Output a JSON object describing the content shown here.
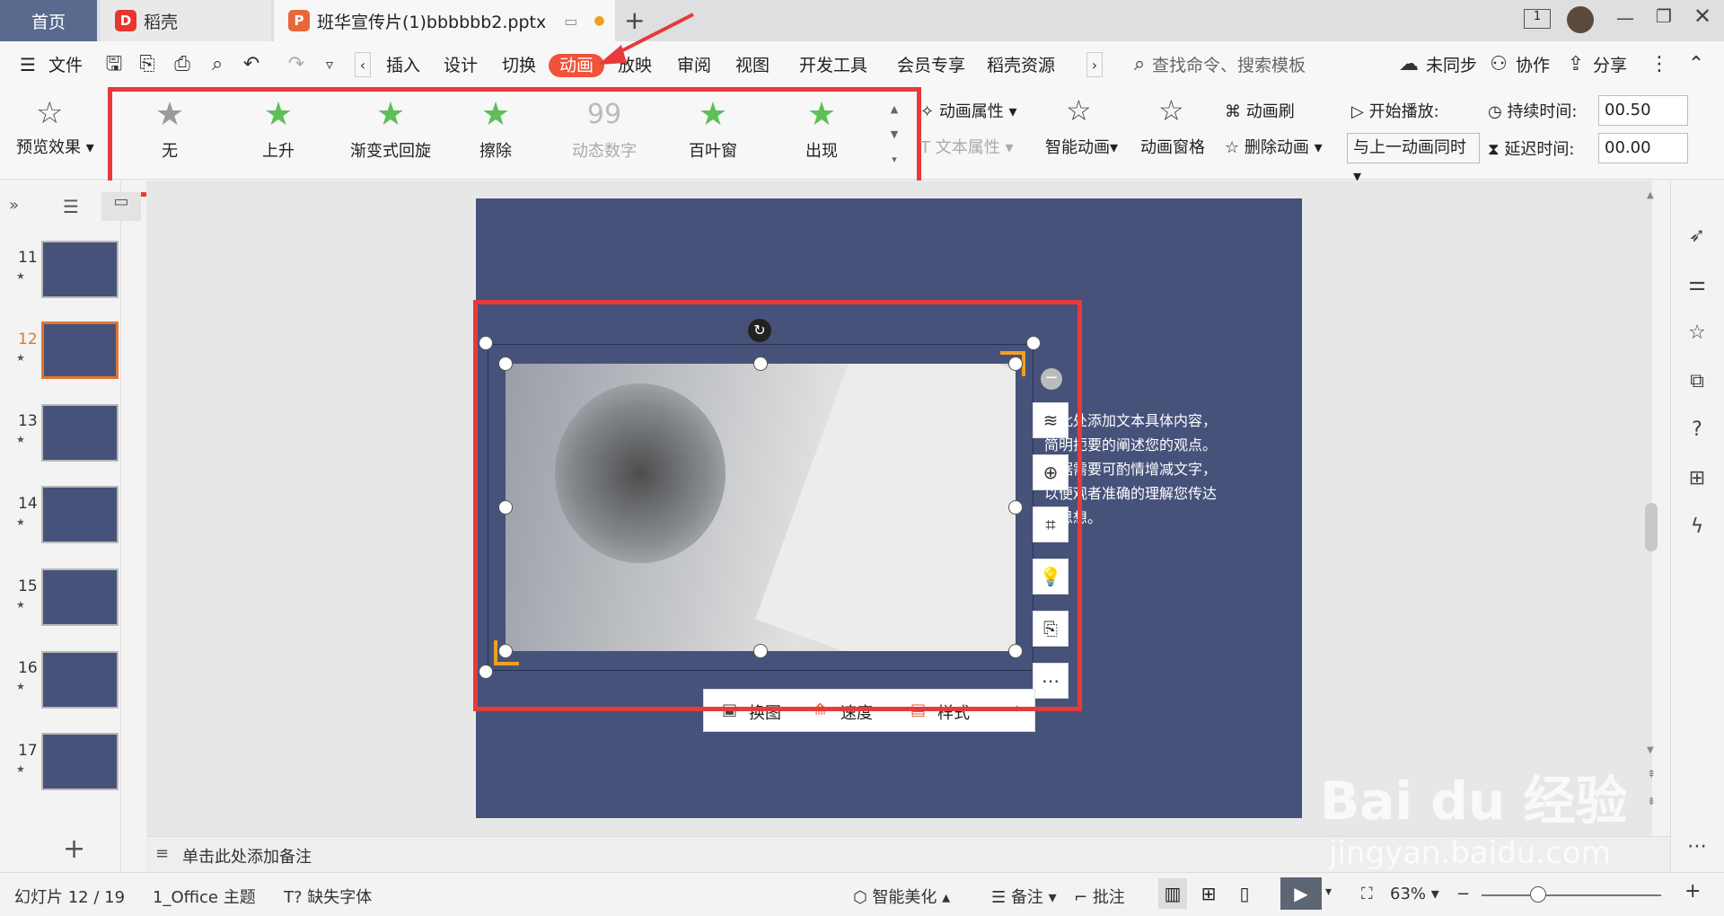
{
  "tabs": {
    "home": "首页",
    "docer": "稻壳",
    "document": "班华宣传片(1)bbbbbb2.pptx"
  },
  "menu": {
    "file": "文件",
    "insert": "插入",
    "design": "设计",
    "transition": "切换",
    "animation": "动画",
    "slideshow": "放映",
    "review": "审阅",
    "view": "视图",
    "developer": "开发工具",
    "member": "会员专享",
    "docer_resources": "稻壳资源",
    "search_placeholder": "查找命令、搜索模板",
    "sync": "未同步",
    "collaborate": "协作",
    "share": "分享"
  },
  "ribbon": {
    "preview_effect": "预览效果",
    "gallery": [
      "无",
      "上升",
      "渐变式回旋",
      "擦除",
      "动态数字",
      "百叶窗",
      "出现"
    ],
    "anim_properties": "动画属性",
    "text_properties": "文本属性",
    "smart_animation": "智能动画",
    "animation_pane": "动画窗格",
    "animation_painter": "动画刷",
    "delete_animation": "删除动画",
    "start_play": "开始播放:",
    "start_option": "与上一动画同时",
    "duration_label": "持续时间:",
    "duration_value": "00.50",
    "delay_label": "延迟时间:",
    "delay_value": "00.00"
  },
  "thumbnails": [
    "11",
    "12",
    "13",
    "14",
    "15",
    "16",
    "17"
  ],
  "active_slide": "12",
  "slide": {
    "text_lines": [
      "击此处添加文本具体内容，",
      "简明扼要的阐述您的观点。",
      "根据需要可酌情增减文字，",
      "以便观者准确的理解您传达",
      "的思想。"
    ]
  },
  "image_toolbar": {
    "replace": "换图",
    "speed": "速度",
    "style": "样式"
  },
  "notes_placeholder": "单击此处添加备注",
  "status": {
    "slide_counter": "幻灯片 12 / 19",
    "theme": "1_Office 主题",
    "missing_font": "缺失字体",
    "smart_beautify": "智能美化",
    "notes": "备注",
    "comments": "批注",
    "zoom": "63%"
  },
  "watermark": {
    "brand": "Bai du 经验",
    "url": "jingyan.baidu.com"
  },
  "colors": {
    "accent": "#f0533a",
    "highlight_box": "#e83a3a",
    "slide_bg": "#46527a",
    "star_green": "#5cbf5a"
  }
}
